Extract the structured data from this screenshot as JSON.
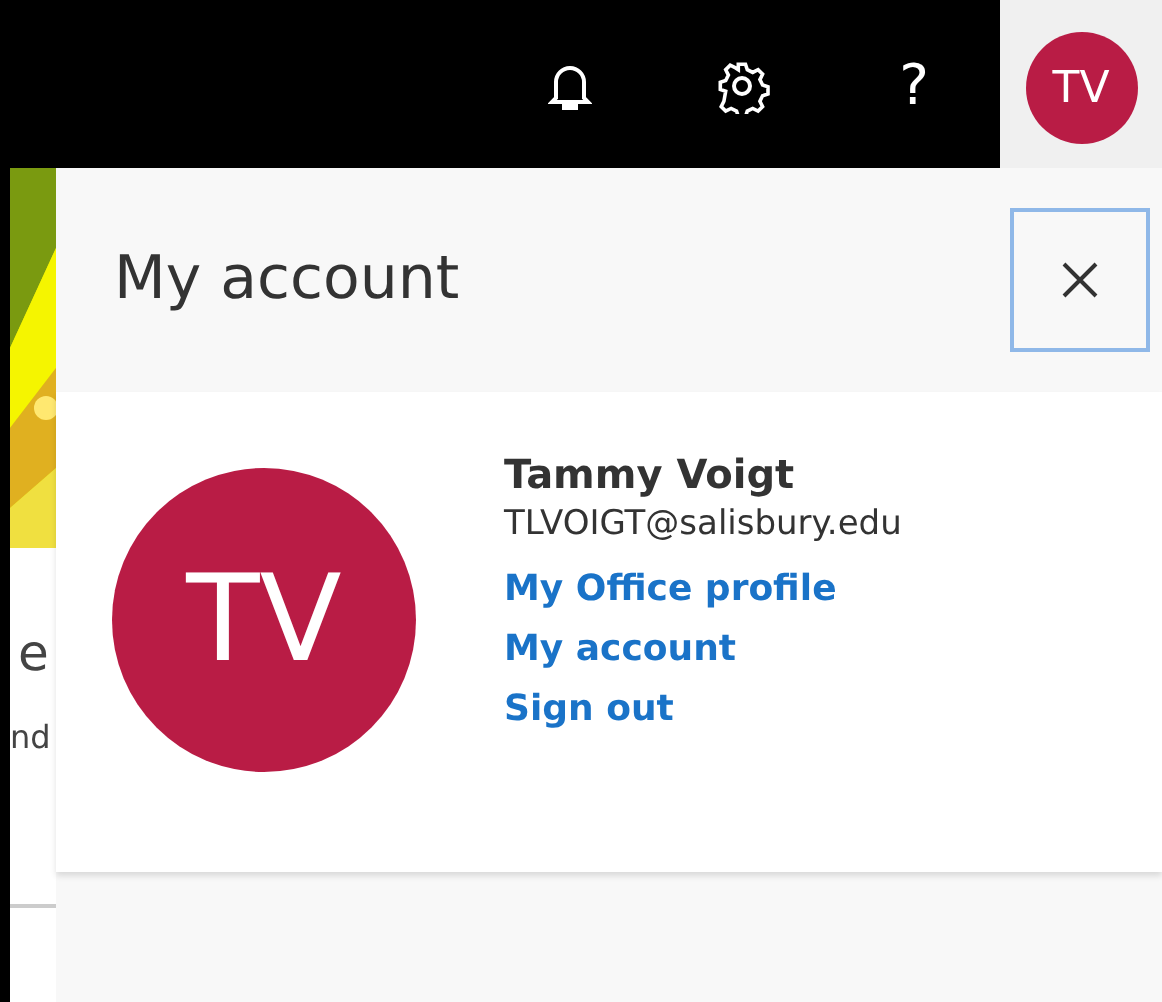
{
  "top_bar": {
    "help": "?",
    "avatar_initials": "TV"
  },
  "background_page": {
    "picture": {
      "kind": "picture"
    },
    "texts": [
      "e",
      "nd"
    ]
  },
  "account_panel": {
    "title": "My account",
    "profile": {
      "initials": "TV",
      "name": "Tammy Voigt",
      "email": "TLVOIGT@salisbury.edu"
    },
    "links": [
      "My Office profile",
      "My account",
      "Sign out"
    ]
  }
}
